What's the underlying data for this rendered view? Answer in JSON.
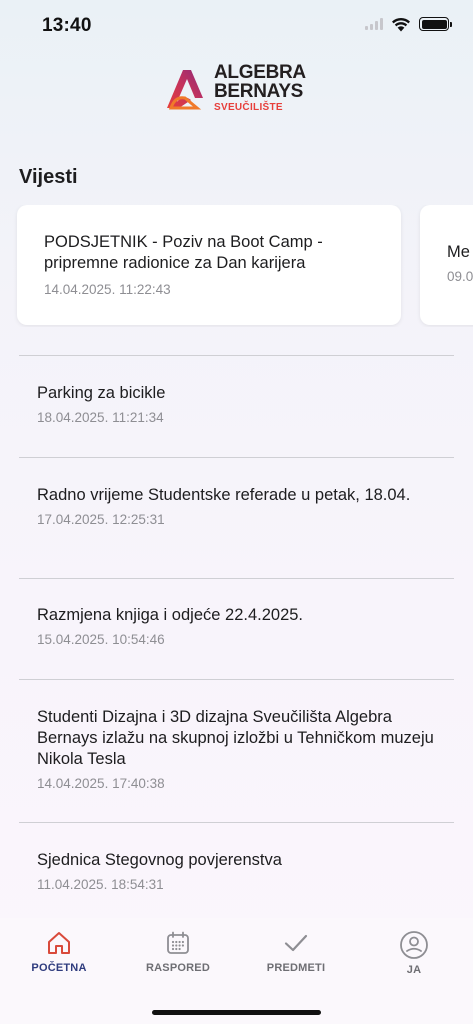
{
  "status": {
    "time": "13:40"
  },
  "logo": {
    "line1": "ALGEBRA",
    "line2": "BERNAYS",
    "line3": "SVEUČILIŠTE"
  },
  "section_title": "Vijesti",
  "featured": [
    {
      "title": "PODSJETNIK - Poziv na Boot Camp - pripremne radionice za Dan karijera",
      "date": "14.04.2025. 11:22:43"
    },
    {
      "title": "Me",
      "date": "09.0"
    }
  ],
  "news": [
    {
      "title": "Parking za bicikle",
      "date": "18.04.2025. 11:21:34"
    },
    {
      "title": "Radno vrijeme Studentske referade u petak, 18.04.",
      "date": "17.04.2025. 12:25:31"
    },
    {
      "title": "Razmjena knjiga i odjeće 22.4.2025.",
      "date": "15.04.2025. 10:54:46"
    },
    {
      "title": "Studenti Dizajna i 3D dizajna Sveučilišta Algebra Bernays izlažu na skupnoj izložbi u Tehničkom muzeju Nikola Tesla",
      "date": "14.04.2025. 17:40:38"
    },
    {
      "title": "Sjednica Stegovnog povjerenstva",
      "date": "11.04.2025. 18:54:31"
    }
  ],
  "tabs": [
    {
      "label": "POČETNA",
      "icon": "home-icon",
      "active": true
    },
    {
      "label": "RASPORED",
      "icon": "calendar-icon",
      "active": false
    },
    {
      "label": "PREDMETI",
      "icon": "checkmark-icon",
      "active": false
    },
    {
      "label": "JA",
      "icon": "profile-icon",
      "active": false
    }
  ],
  "colors": {
    "accent": "#2f3c7e",
    "brand_red": "#e73e3a",
    "home_icon": "#d94a3b"
  }
}
